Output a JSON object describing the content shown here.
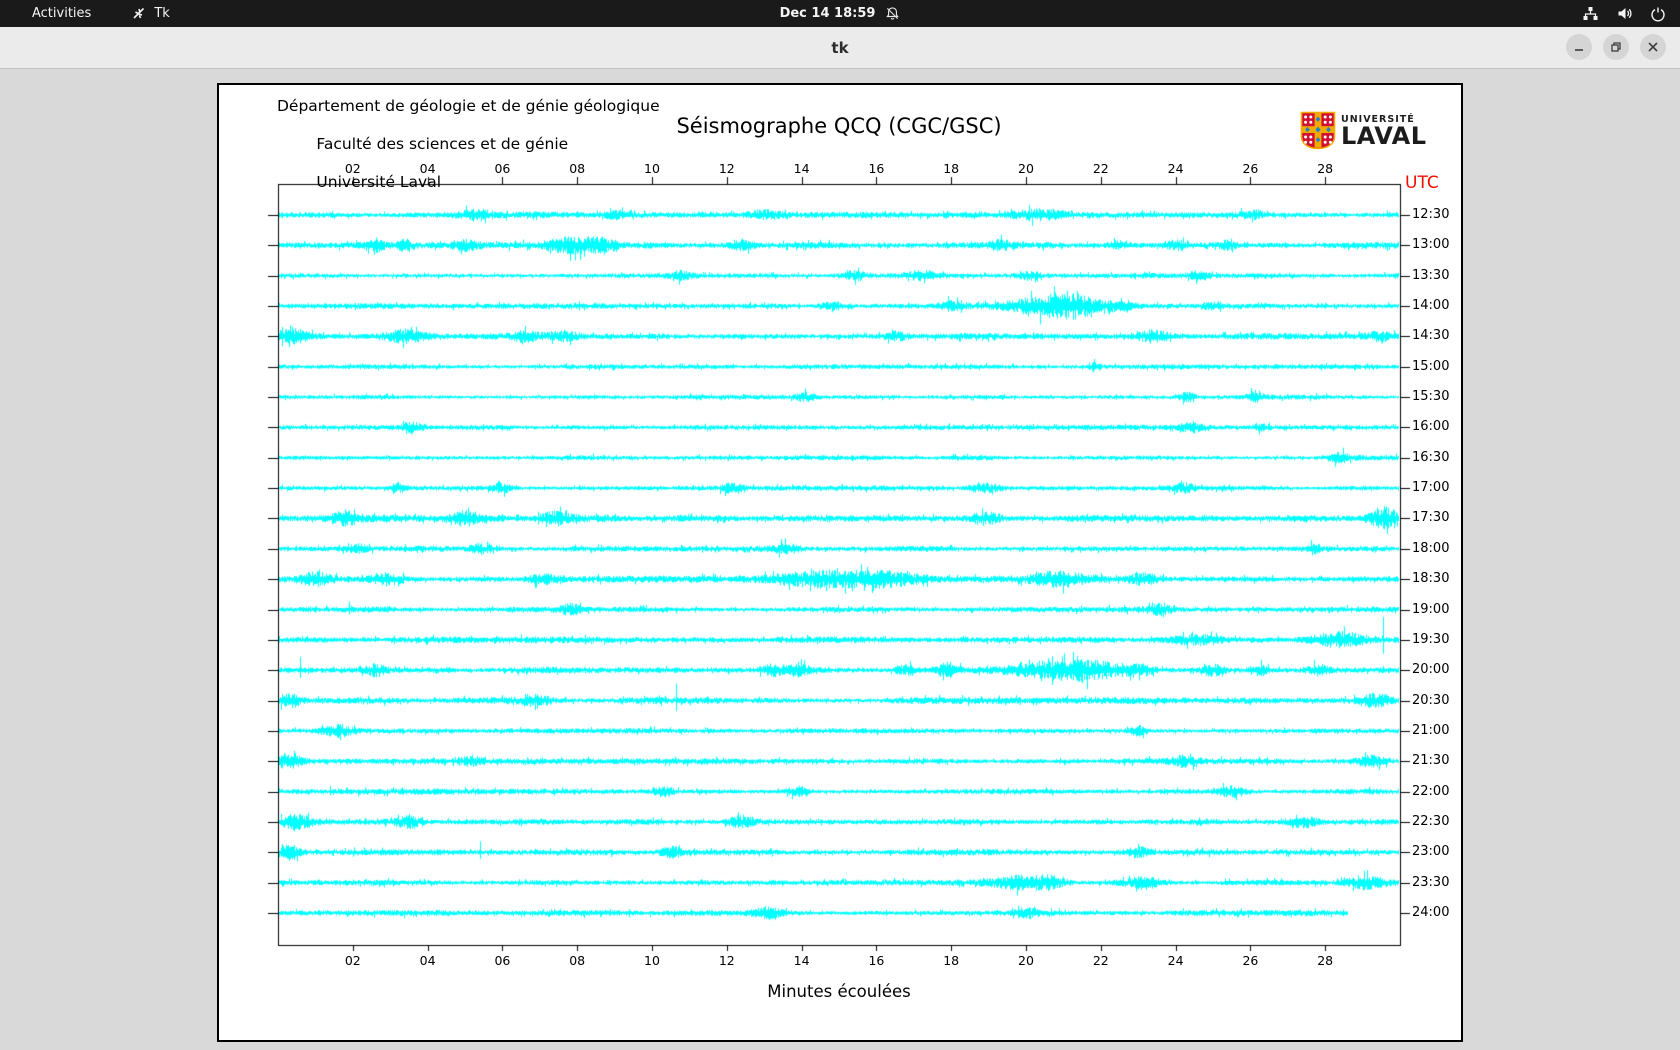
{
  "top_bar": {
    "activities_label": "Activities",
    "app_menu": {
      "icon": "tk-feather-icon",
      "label": "Tk"
    },
    "clock": "Dec 14  18:59",
    "dnd_icon": "notifications-disabled-icon",
    "status_icons": [
      "network-wired-icon",
      "volume-icon",
      "power-icon"
    ]
  },
  "window": {
    "title": "tk",
    "controls": [
      "minimize",
      "maximize",
      "close"
    ]
  },
  "canvas_panel": {
    "institution_lines": [
      "Département de géologie et de génie géologique",
      "Faculté des sciences et de génie",
      "Université Laval"
    ],
    "title": "Séismographe QCQ (CGC/GSC)",
    "logo": {
      "small_text": "UNIVERSITÉ",
      "large_text": "LAVAL",
      "shield_red": "#d21034",
      "shield_gold": "#f2a900",
      "shield_blue": "#1f86c8"
    },
    "utc_label": "UTC",
    "utc_color": "#ee1100",
    "xlabel": "Minutes écoulées",
    "trace_color": "#00ffff"
  },
  "chart_data": {
    "type": "line",
    "subtype": "seismogram-helicorder",
    "title": "Séismographe QCQ (CGC/GSC)",
    "xlabel": "Minutes écoulées",
    "ylabel": "UTC",
    "x_range_minutes": [
      0,
      30
    ],
    "row_interval_minutes": 30,
    "x_tick_labels": [
      "02",
      "04",
      "06",
      "08",
      "10",
      "12",
      "14",
      "16",
      "18",
      "20",
      "22",
      "24",
      "26",
      "28"
    ],
    "x_tick_minutes": [
      2,
      4,
      6,
      8,
      10,
      12,
      14,
      16,
      18,
      20,
      22,
      24,
      26,
      28
    ],
    "rows": [
      {
        "label": "12:30",
        "noise": 2.3,
        "events": [
          [
            5.3,
            0.35,
            3.5
          ],
          [
            9.0,
            0.2,
            2.5
          ],
          [
            13.0,
            0.3,
            3
          ],
          [
            20.3,
            0.5,
            4
          ],
          [
            26.0,
            0.2,
            2.5
          ]
        ]
      },
      {
        "label": "13:00",
        "noise": 2.3,
        "events": [
          [
            2.6,
            0.15,
            4
          ],
          [
            3.4,
            0.15,
            4
          ],
          [
            5.0,
            0.25,
            3
          ],
          [
            7.9,
            0.45,
            5.5
          ],
          [
            8.7,
            0.25,
            4.5
          ],
          [
            12.4,
            0.2,
            3.5
          ],
          [
            19.3,
            0.2,
            3
          ],
          [
            22.4,
            0.15,
            2.5
          ],
          [
            24.0,
            0.2,
            3
          ],
          [
            25.4,
            0.15,
            3
          ]
        ]
      },
      {
        "label": "13:30",
        "noise": 1.9,
        "events": [
          [
            10.8,
            0.2,
            3.5
          ],
          [
            15.4,
            0.2,
            3
          ],
          [
            17.2,
            0.3,
            3
          ],
          [
            20.1,
            0.2,
            2.5
          ],
          [
            24.6,
            0.2,
            3
          ]
        ]
      },
      {
        "label": "14:00",
        "noise": 2.0,
        "events": [
          [
            14.8,
            0.2,
            3
          ],
          [
            18.0,
            0.2,
            3
          ],
          [
            20.5,
            0.7,
            7
          ],
          [
            21.3,
            0.4,
            6
          ],
          [
            22.4,
            0.3,
            4
          ],
          [
            25.0,
            0.2,
            3
          ]
        ]
      },
      {
        "label": "14:30",
        "noise": 2.3,
        "events": [
          [
            0.4,
            0.3,
            5
          ],
          [
            3.4,
            0.4,
            4.5
          ],
          [
            6.6,
            0.3,
            3.5
          ],
          [
            7.6,
            0.3,
            3
          ],
          [
            16.5,
            0.2,
            3
          ],
          [
            23.4,
            0.3,
            4
          ],
          [
            29.5,
            0.25,
            3
          ]
        ]
      },
      {
        "label": "15:00",
        "noise": 1.7,
        "events": [
          [
            21.8,
            0.12,
            3.5
          ]
        ]
      },
      {
        "label": "15:30",
        "noise": 1.7,
        "events": [
          [
            14.1,
            0.2,
            3
          ],
          [
            24.3,
            0.15,
            3.5
          ],
          [
            26.1,
            0.15,
            3
          ]
        ]
      },
      {
        "label": "16:00",
        "noise": 1.8,
        "events": [
          [
            3.6,
            0.2,
            3.5
          ],
          [
            24.4,
            0.2,
            3.5
          ],
          [
            26.3,
            0.15,
            2.5
          ]
        ]
      },
      {
        "label": "16:30",
        "noise": 1.7,
        "events": [
          [
            28.4,
            0.25,
            3.5
          ]
        ]
      },
      {
        "label": "17:00",
        "noise": 1.8,
        "events": [
          [
            3.2,
            0.15,
            3
          ],
          [
            6.0,
            0.2,
            3
          ],
          [
            12.1,
            0.2,
            3
          ],
          [
            18.9,
            0.3,
            3.5
          ],
          [
            24.2,
            0.2,
            3
          ]
        ]
      },
      {
        "label": "17:30",
        "noise": 2.5,
        "events": [
          [
            1.8,
            0.3,
            4
          ],
          [
            5.0,
            0.3,
            4
          ],
          [
            7.4,
            0.3,
            4.5
          ],
          [
            18.9,
            0.25,
            4
          ],
          [
            29.6,
            0.3,
            7
          ]
        ]
      },
      {
        "label": "18:00",
        "noise": 2.0,
        "events": [
          [
            2.1,
            0.2,
            3
          ],
          [
            5.4,
            0.2,
            3.5
          ],
          [
            13.6,
            0.25,
            3.5
          ],
          [
            27.7,
            0.15,
            3
          ]
        ]
      },
      {
        "label": "18:30",
        "noise": 2.5,
        "events": [
          [
            1.0,
            0.3,
            4.5
          ],
          [
            2.9,
            0.3,
            4
          ],
          [
            7.1,
            0.3,
            3.5
          ],
          [
            14.5,
            1.2,
            4.5
          ],
          [
            16.3,
            0.8,
            4
          ],
          [
            20.8,
            0.5,
            5
          ],
          [
            23.1,
            0.3,
            4
          ]
        ]
      },
      {
        "label": "19:00",
        "noise": 2.1,
        "events": [
          [
            1.9,
            0.06,
            8
          ],
          [
            7.8,
            0.2,
            3.5
          ],
          [
            23.6,
            0.2,
            3.5
          ]
        ]
      },
      {
        "label": "19:30",
        "noise": 2.3,
        "events": [
          [
            24.5,
            0.5,
            3.5
          ],
          [
            28.4,
            0.5,
            5.5
          ],
          [
            29.55,
            0.05,
            23
          ]
        ]
      },
      {
        "label": "20:00",
        "noise": 2.3,
        "events": [
          [
            0.6,
            0.06,
            13
          ],
          [
            2.6,
            0.2,
            4
          ],
          [
            13.2,
            0.2,
            4
          ],
          [
            13.9,
            0.2,
            4.5
          ],
          [
            16.8,
            0.2,
            4
          ],
          [
            17.9,
            0.2,
            5
          ],
          [
            20.5,
            0.7,
            6
          ],
          [
            21.8,
            0.6,
            6
          ],
          [
            23.0,
            0.3,
            4
          ],
          [
            25.0,
            0.2,
            4
          ],
          [
            26.2,
            0.2,
            4
          ],
          [
            27.8,
            0.2,
            4
          ]
        ]
      },
      {
        "label": "20:30",
        "noise": 2.3,
        "events": [
          [
            0.3,
            0.2,
            5
          ],
          [
            6.8,
            0.3,
            4
          ],
          [
            10.65,
            0.06,
            17
          ],
          [
            29.3,
            0.3,
            4.5
          ]
        ]
      },
      {
        "label": "21:00",
        "noise": 1.9,
        "events": [
          [
            1.6,
            0.3,
            4
          ],
          [
            23.0,
            0.2,
            3.5
          ]
        ]
      },
      {
        "label": "21:30",
        "noise": 2.1,
        "events": [
          [
            0.2,
            0.3,
            5
          ],
          [
            5.2,
            0.2,
            3.5
          ],
          [
            24.2,
            0.25,
            3.5
          ],
          [
            29.2,
            0.3,
            4
          ]
        ]
      },
      {
        "label": "22:00",
        "noise": 2.1,
        "events": [
          [
            1.4,
            0.07,
            6
          ],
          [
            10.3,
            0.2,
            3.5
          ],
          [
            13.9,
            0.2,
            3.5
          ],
          [
            25.5,
            0.25,
            4
          ]
        ]
      },
      {
        "label": "22:30",
        "noise": 2.2,
        "events": [
          [
            0.5,
            0.3,
            5
          ],
          [
            3.5,
            0.25,
            4.5
          ],
          [
            12.4,
            0.25,
            4
          ],
          [
            27.4,
            0.3,
            4
          ]
        ]
      },
      {
        "label": "23:00",
        "noise": 2.1,
        "events": [
          [
            0.3,
            0.2,
            5
          ],
          [
            5.4,
            0.06,
            11
          ],
          [
            10.5,
            0.2,
            3.5
          ],
          [
            23.0,
            0.2,
            3.5
          ]
        ]
      },
      {
        "label": "23:30",
        "noise": 2.1,
        "events": [
          [
            19.8,
            0.5,
            4.5
          ],
          [
            20.6,
            0.3,
            4
          ],
          [
            23.1,
            0.3,
            4
          ],
          [
            29.1,
            0.4,
            5
          ]
        ]
      },
      {
        "label": "24:00",
        "noise": 2.1,
        "end_minute": 28.6,
        "events": [
          [
            13.1,
            0.3,
            4
          ],
          [
            20.0,
            0.2,
            3
          ]
        ]
      }
    ]
  }
}
